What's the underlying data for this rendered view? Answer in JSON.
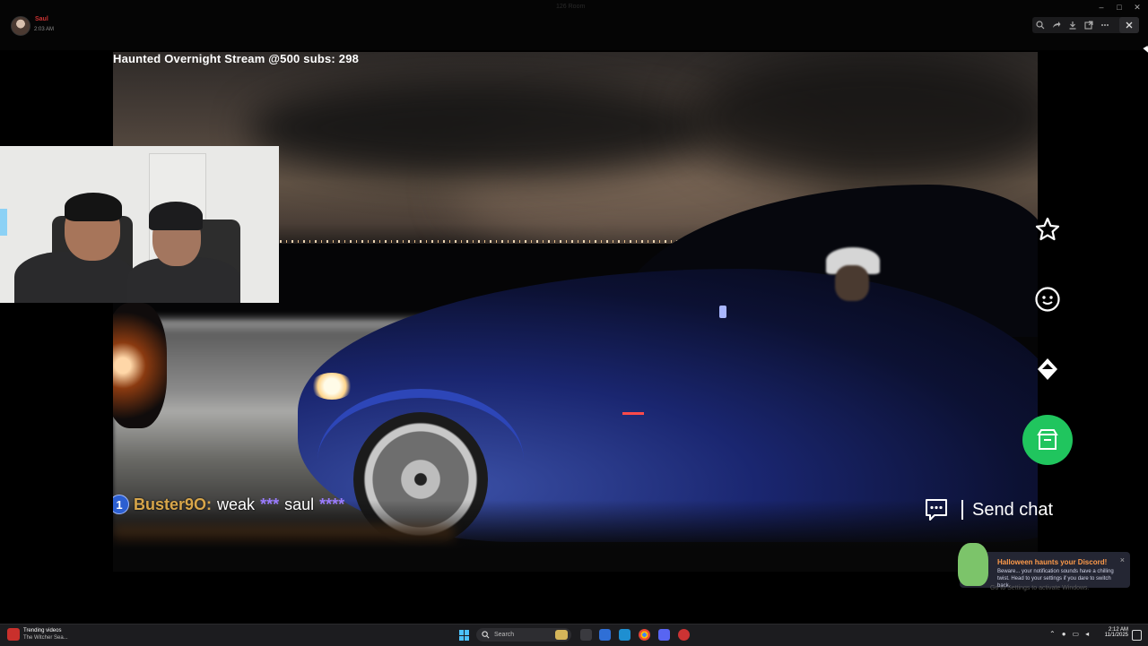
{
  "window": {
    "user_name": "Saul",
    "post_time": "2:03 AM",
    "ghost_title": "126 Room",
    "controls": [
      "–",
      "□",
      "✕"
    ]
  },
  "toolbar": {
    "icons": [
      "zoom-icon",
      "share-icon",
      "download-icon",
      "open-external-icon",
      "more-icon",
      "close-icon"
    ]
  },
  "video": {
    "title": "Haunted Overnight Stream @500 subs: 298",
    "chat": {
      "badge": "1",
      "username": "Buster9O",
      "separator": ":",
      "message_start": "weak",
      "censor1": "***",
      "message_mid": "saul",
      "censor2": "****"
    }
  },
  "side_actions": [
    {
      "name": "favorite",
      "icon": "star-icon"
    },
    {
      "name": "emote",
      "icon": "smiley-icon"
    },
    {
      "name": "gem",
      "icon": "diamond-icon"
    },
    {
      "name": "shop",
      "icon": "store-icon",
      "color": "#20c55e"
    }
  ],
  "send_chat": {
    "label": "Send chat"
  },
  "toast": {
    "title": "Halloween haunts your Discord!",
    "body": "Beware... your notification sounds have a chilling twist. Head to your settings if you dare to switch back.",
    "close": "×"
  },
  "activation_notice": "Go to Settings to activate Windows.",
  "taskbar": {
    "widget_title": "Trending videos",
    "widget_sub": "The Witcher Sea...",
    "search_placeholder": "Search",
    "time": "2:12 AM",
    "date": "11/1/2025",
    "tray_up": "⌃"
  },
  "colors": {
    "accent_green": "#20c55e",
    "chat_username": "#d8a64a",
    "censor": "#9a7cff",
    "toast_title": "#ff9b4a"
  }
}
